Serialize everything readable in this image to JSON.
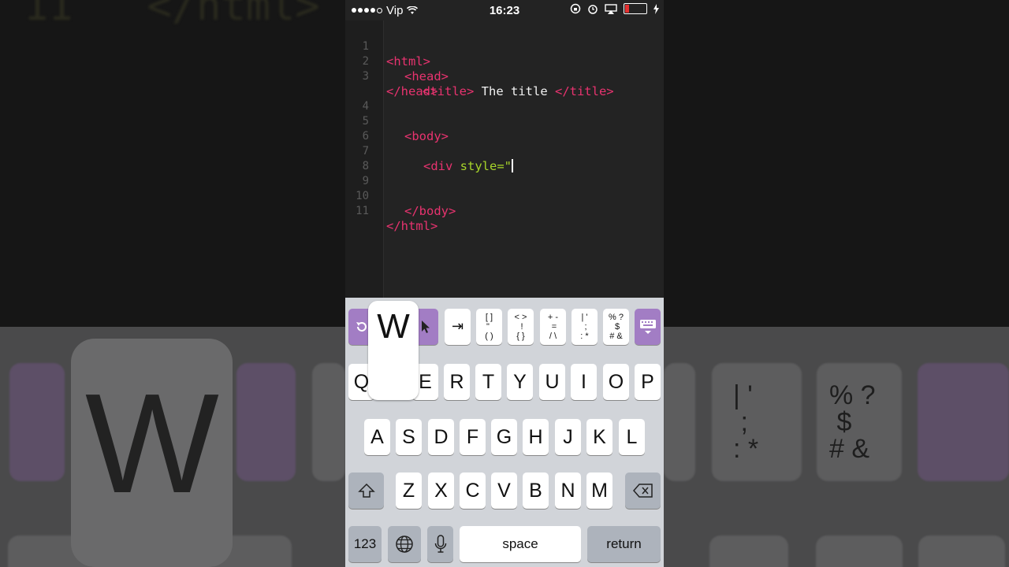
{
  "status_bar": {
    "carrier": "Vip",
    "time": "16:23"
  },
  "editor": {
    "lines": [
      {
        "n": "1",
        "tag_open": "<html>"
      },
      {
        "n": "2",
        "tag_open": "<head>"
      },
      {
        "n": "3",
        "tag_open": "<title>",
        "text": " The title ",
        "tag_close": "</title>"
      },
      {
        "n": "4",
        "tag_open": "</head>"
      },
      {
        "n": "4"
      },
      {
        "n": "5",
        "tag_open": "<body>"
      },
      {
        "n": "6"
      },
      {
        "n": "7",
        "tag_open": "<div",
        "attr": " style=\""
      },
      {
        "n": "8"
      },
      {
        "n": "9"
      },
      {
        "n": "10",
        "tag_open": "</body>"
      },
      {
        "n": "11",
        "tag_open": "</html>"
      }
    ]
  },
  "accessory_bar": {
    "tab_label": "⇥",
    "sym1": "[ ]\n\" \n( )",
    "sym2": "< >\n !\n{ }",
    "sym3": "+ -\n =\n/ \\",
    "sym4": "| '\n ;\n: *",
    "sym5": "% ?\n $\n# &"
  },
  "keyboard": {
    "popup_letter": "W",
    "row1": [
      "Q",
      "E",
      "R",
      "T",
      "Y",
      "U",
      "I",
      "O",
      "P"
    ],
    "row2": [
      "A",
      "S",
      "D",
      "F",
      "G",
      "H",
      "J",
      "K",
      "L"
    ],
    "row3": [
      "Z",
      "X",
      "C",
      "V",
      "B",
      "N",
      "M"
    ],
    "numbers_label": "123",
    "space_label": "space",
    "return_label": "return"
  },
  "background": {
    "code_fragment": "11   </html>"
  },
  "colors": {
    "tag": "#e8336f",
    "attr": "#a7d42a",
    "text": "#f2f2f2",
    "accent": "#a27dc4"
  }
}
